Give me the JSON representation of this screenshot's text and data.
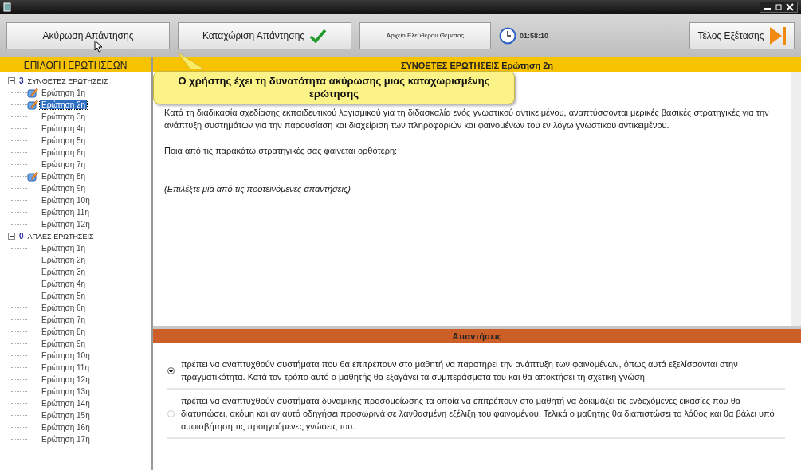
{
  "toolbar": {
    "cancel_button": "Ακύρωση Απάντησης",
    "submit_button": "Καταχώριση Απάντησης",
    "file_button": "Αρχείο Ελεύθερου Θέματος",
    "timer": "01:58:10",
    "finish_button": "Τέλος Εξέτασης"
  },
  "tooltip": "Ο χρήστης έχει τη δυνατότητα ακύρωσης μιας καταχωρισμένης ερώτησης",
  "sidebar": {
    "title": "ΕΠΙΛΟΓΗ ΕΡΩΤΗΣΕΩΝ",
    "groups": [
      {
        "count": "3",
        "label": "ΣΥΝΘΕΤΕΣ ΕΡΩΤΗΣΕΙΣ",
        "expanded": true,
        "children": [
          {
            "label": "Ερώτηση 1η",
            "answered": true,
            "selected": false
          },
          {
            "label": "Ερώτηση 2η",
            "answered": true,
            "selected": true
          },
          {
            "label": "Ερώτηση 3η",
            "answered": false,
            "selected": false
          },
          {
            "label": "Ερώτηση 4η",
            "answered": false,
            "selected": false
          },
          {
            "label": "Ερώτηση 5η",
            "answered": false,
            "selected": false
          },
          {
            "label": "Ερώτηση 6η",
            "answered": false,
            "selected": false
          },
          {
            "label": "Ερώτηση 7η",
            "answered": false,
            "selected": false
          },
          {
            "label": "Ερώτηση 8η",
            "answered": true,
            "selected": false
          },
          {
            "label": "Ερώτηση 9η",
            "answered": false,
            "selected": false
          },
          {
            "label": "Ερώτηση 10η",
            "answered": false,
            "selected": false
          },
          {
            "label": "Ερώτηση 11η",
            "answered": false,
            "selected": false
          },
          {
            "label": "Ερώτηση 12η",
            "answered": false,
            "selected": false
          }
        ]
      },
      {
        "count": "0",
        "label": "ΑΠΛΕΣ ΕΡΩΤΗΣΕΙΣ",
        "expanded": true,
        "children": [
          {
            "label": "Ερώτηση 1η",
            "answered": false,
            "selected": false
          },
          {
            "label": "Ερώτηση 2η",
            "answered": false,
            "selected": false
          },
          {
            "label": "Ερώτηση 3η",
            "answered": false,
            "selected": false
          },
          {
            "label": "Ερώτηση 4η",
            "answered": false,
            "selected": false
          },
          {
            "label": "Ερώτηση 5η",
            "answered": false,
            "selected": false
          },
          {
            "label": "Ερώτηση 6η",
            "answered": false,
            "selected": false
          },
          {
            "label": "Ερώτηση 7η",
            "answered": false,
            "selected": false
          },
          {
            "label": "Ερώτηση 8η",
            "answered": false,
            "selected": false
          },
          {
            "label": "Ερώτηση 9η",
            "answered": false,
            "selected": false
          },
          {
            "label": "Ερώτηση 10η",
            "answered": false,
            "selected": false
          },
          {
            "label": "Ερώτηση 11η",
            "answered": false,
            "selected": false
          },
          {
            "label": "Ερώτηση 12η",
            "answered": false,
            "selected": false
          },
          {
            "label": "Ερώτηση 13η",
            "answered": false,
            "selected": false
          },
          {
            "label": "Ερώτηση 14η",
            "answered": false,
            "selected": false
          },
          {
            "label": "Ερώτηση 15η",
            "answered": false,
            "selected": false
          },
          {
            "label": "Ερώτηση 16η",
            "answered": false,
            "selected": false
          },
          {
            "label": "Ερώτηση 17η",
            "answered": false,
            "selected": false
          }
        ]
      }
    ]
  },
  "question": {
    "header": "ΣΥΝΘΕΤΕΣ ΕΡΩΤΗΣΕΙΣ Ερώτηση 2η",
    "paragraphs": [
      {
        "kind": "normal",
        "text": "Κατά τη διαδικασία σχεδίασης εκπαιδευτικού λογισμικού για τη διδασκαλία ενός γνωστικού αντικειμένου, αναπτύσσονται μερικές βασικές στρατηγικές για την ανάπτυξη συστημάτων για την παρουσίαση και διαχείριση των πληροφοριών και φαινομένων  του εν λόγω γνωστικού αντικειμένου."
      },
      {
        "kind": "normal",
        "text": "Ποια από τις παρακάτω στρατηγικές σας φαίνεται ορθότερη:"
      },
      {
        "kind": "hint",
        "text": "(Επιλέξτε μια από τις προτεινόμενες απαντήσεις)"
      }
    ]
  },
  "answers": {
    "header": "Απαντήσεις",
    "options": [
      {
        "text": "πρέπει να αναπτυχθούν συστήματα που θα επιτρέπουν στο μαθητή να παρατηρεί την ανάπτυξη των φαινομένων, όπως αυτά εξελίσσονται στην πραγματικότητα. Κατά τον τρόπο αυτό ο μαθητής θα εξαγάγει τα συμπεράσματα του και θα αποκτήσει τη σχετική γνώση.",
        "selected": true
      },
      {
        "text": "πρέπει να αναπτυχθούν συστήματα δυναμικής προσομοίωσης τα οποία να επιτρέπουν στο μαθητή να δοκιμάζει τις ενδεχόμενες εικασίες που θα διατυπώσει, ακόμη και αν αυτό οδηγήσει προσωρινά σε λανθασμένη εξέλιξη του φαινομένου. Τελικά ο μαθητής θα διαπιστώσει το λάθος και θα βάλει υπό αμφισβήτηση τις προηγούμενες γνώσεις του.",
        "selected": false
      }
    ]
  }
}
